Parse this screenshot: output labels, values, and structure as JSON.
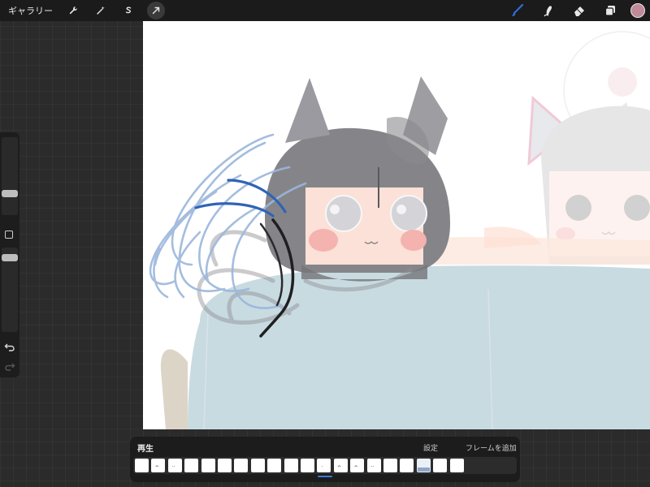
{
  "topbar": {
    "gallery_label": "ギャラリー",
    "tools_left": [
      {
        "icon": "wrench-icon",
        "name": "actions"
      },
      {
        "icon": "magic-wand-icon",
        "name": "adjustments"
      },
      {
        "icon": "selection-s-icon",
        "name": "selection"
      },
      {
        "icon": "transform-arrow-icon",
        "name": "transform"
      }
    ],
    "tools_right": [
      {
        "icon": "brush-icon",
        "name": "paint"
      },
      {
        "icon": "smudge-icon",
        "name": "smudge"
      },
      {
        "icon": "eraser-icon",
        "name": "erase"
      },
      {
        "icon": "layers-icon",
        "name": "layers"
      }
    ],
    "active_color": "#c08a98"
  },
  "sidebar": {
    "size_slider_value": 0.25,
    "opacity_slider_value": 0.35,
    "undo_icon": "undo-icon",
    "redo_icon": "redo-icon"
  },
  "timeline": {
    "play_label": "再生",
    "settings_label": "設定",
    "add_frame_label": "フレームを追加",
    "frames": [
      {
        "mark": ""
      },
      {
        "mark": "ᴖ"
      },
      {
        "mark": "··"
      },
      {
        "mark": ""
      },
      {
        "mark": ""
      },
      {
        "mark": ""
      },
      {
        "mark": ""
      },
      {
        "mark": ""
      },
      {
        "mark": ""
      },
      {
        "mark": ""
      },
      {
        "mark": ""
      },
      {
        "mark": "·"
      },
      {
        "mark": "ᴖ"
      },
      {
        "mark": "ᴖ"
      },
      {
        "mark": "··"
      },
      {
        "mark": ""
      },
      {
        "mark": ""
      },
      {
        "mark": ""
      },
      {
        "mark": ""
      },
      {
        "mark": ""
      }
    ],
    "current_frame_index": 11
  },
  "colors": {
    "accent_blue": "#2f6fd6",
    "app_background": "#2b2b2b",
    "canvas_background": "#ffffff"
  }
}
